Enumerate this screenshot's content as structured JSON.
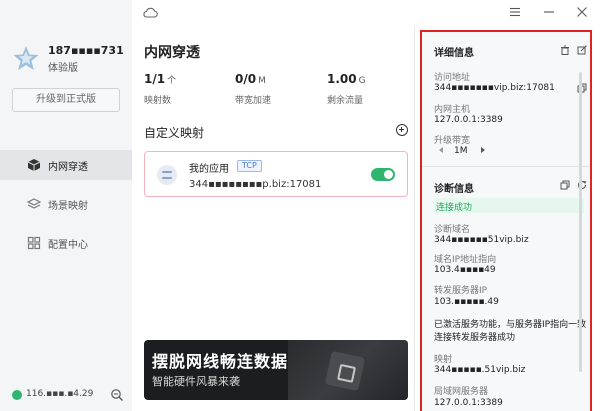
{
  "user": {
    "phone": "187▪▪▪▪731",
    "plan": "体验版"
  },
  "sidebar": {
    "upgrade_label": "升级到正式版",
    "items": [
      {
        "label": "内网穿透",
        "icon": "cube-icon"
      },
      {
        "label": "场景映射",
        "icon": "layers-icon"
      },
      {
        "label": "配置中心",
        "icon": "grid-icon"
      }
    ],
    "ip": "116.▪▪▪.▪4.29"
  },
  "main": {
    "title": "内网穿透",
    "stats": [
      {
        "value": "1/1",
        "unit": "个",
        "label": "映射数"
      },
      {
        "value": "0/0",
        "unit": "M",
        "label": "带宽加速"
      },
      {
        "value": "1.00",
        "unit": "G",
        "label": "剩余流量"
      }
    ],
    "section_title": "自定义映射",
    "mapping": {
      "name": "我的应用",
      "protocol": "TCP",
      "address": "344▪▪▪▪▪▪▪▪p.biz:17081",
      "enabled": true
    },
    "banner": {
      "headline": "摆脱网线畅连数据",
      "subline": "智能硬件风暴来袭"
    }
  },
  "detail": {
    "title": "详细信息",
    "access_label": "访问地址",
    "access_value": "344▪▪▪▪▪▪▪vip.biz:17081",
    "host_label": "内网主机",
    "host_value": "127.0.0.1:3389",
    "bandwidth_label": "升级带宽",
    "bandwidth_value": "1M"
  },
  "diag": {
    "title": "诊断信息",
    "status": "连接成功",
    "domain_label": "诊断域名",
    "domain_value": "344▪▪▪▪▪▪51vip.biz",
    "dns_label": "域名IP地址指向",
    "dns_value": "103.4▪▪▪▪49",
    "forward_label": "转发服务器IP",
    "forward_value": "103.▪▪▪▪▪.49",
    "msg1": "已激活服务功能，与服务器IP指向一致",
    "msg2": "连接转发服务器成功",
    "map_label": "映射",
    "map_value": "344▪▪▪▪▪.51vip.biz",
    "lan_label": "局域网服务器",
    "lan_value": "127.0.0.1:3389"
  }
}
